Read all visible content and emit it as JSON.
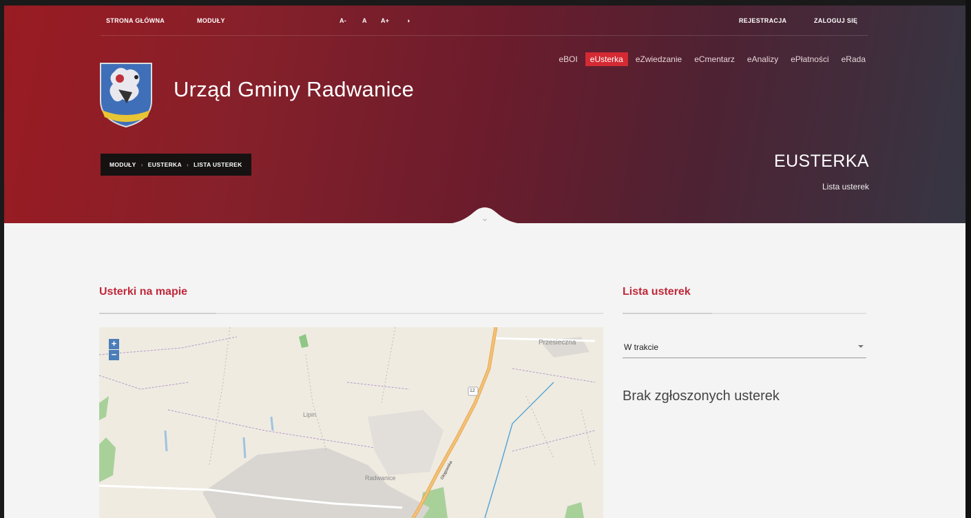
{
  "topbar": {
    "home": "STRONA GŁÓWNA",
    "modules": "MODUŁY",
    "font_smaller": "A-",
    "font_normal": "A",
    "font_larger": "A+",
    "contrast": "◑",
    "register": "REJESTRACJA",
    "login": "ZALOGUJ SIĘ"
  },
  "module_nav": [
    {
      "label": "eBOI",
      "active": false
    },
    {
      "label": "eUsterka",
      "active": true
    },
    {
      "label": "eZwiedzanie",
      "active": false
    },
    {
      "label": "eCmentarz",
      "active": false
    },
    {
      "label": "eAnalizy",
      "active": false
    },
    {
      "label": "ePłatności",
      "active": false
    },
    {
      "label": "eRada",
      "active": false
    }
  ],
  "site": {
    "title": "Urząd Gminy Radwanice",
    "crest_icon": "coat-of-arms-icon"
  },
  "breadcrumb": [
    "MODUŁY",
    "EUSTERKA",
    "LISTA USTEREK"
  ],
  "module": {
    "title": "EUSTERKA",
    "subtitle": "Lista usterek"
  },
  "map_section": {
    "title": "Usterki na mapie",
    "zoom_in": "+",
    "zoom_out": "−",
    "labels": {
      "town1": "Przesieczna",
      "town2": "Lipin",
      "town3": "Radwanice",
      "road_number": "12",
      "road_name": "Głogowska"
    }
  },
  "list_section": {
    "title": "Lista usterek",
    "filter_value": "W trakcie",
    "empty_text": "Brak zgłoszonych usterek"
  },
  "colors": {
    "accent": "#d42a33",
    "section_title": "#c0283a",
    "header_start": "#9a1b22",
    "header_end": "#363643"
  }
}
